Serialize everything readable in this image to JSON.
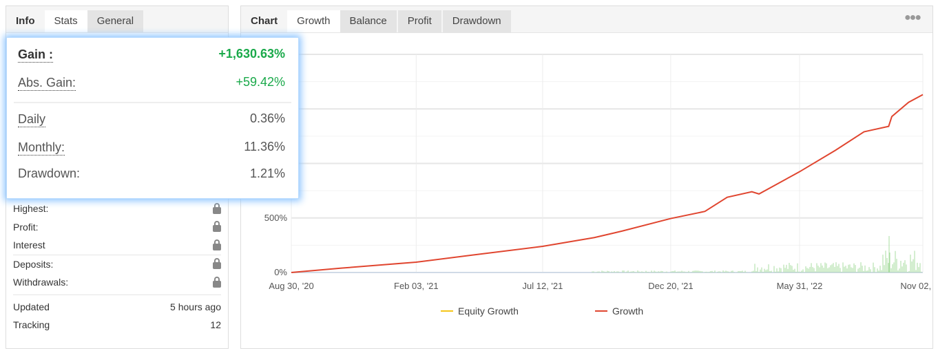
{
  "left": {
    "tabs": [
      "Info",
      "Stats",
      "General"
    ],
    "rows1": [
      {
        "label": "Highest:"
      },
      {
        "label": "Profit:"
      },
      {
        "label": "Interest"
      }
    ],
    "rows2": [
      {
        "label": "Deposits:"
      },
      {
        "label": "Withdrawals:"
      }
    ],
    "rows3": [
      {
        "label": "Updated",
        "value": "5 hours ago"
      },
      {
        "label": "Tracking",
        "value": "12"
      }
    ]
  },
  "popup": {
    "gain_label": "Gain :",
    "gain": "+1,630.63%",
    "abs_label": "Abs. Gain:",
    "abs": "+59.42%",
    "daily_label": "Daily",
    "daily": "0.36%",
    "monthly_label": "Monthly:",
    "monthly": "11.36%",
    "dd_label": "Drawdown:",
    "dd": "1.21%"
  },
  "right": {
    "tabs": [
      "Chart",
      "Growth",
      "Balance",
      "Profit",
      "Drawdown"
    ],
    "active_tab": "Growth",
    "menu_icon": "more-dots-icon"
  },
  "colors": {
    "growth": "#e0452f",
    "equity": "#f5c518",
    "profit_bars": "#a8dca0",
    "gain": "#1aa94a"
  },
  "chart_data": {
    "type": "line",
    "ylim": [
      0,
      2000
    ],
    "yticks": [
      "0%",
      "500%"
    ],
    "ytick_values": [
      0,
      500
    ],
    "xticks": [
      "Aug 30, '20",
      "Feb 03, '21",
      "Jul 12, '21",
      "Dec 20, '21",
      "May 31, '22",
      "Nov 02, '22"
    ],
    "xtick_dates": [
      "2020-08-30",
      "2021-02-03",
      "2021-07-12",
      "2021-12-20",
      "2022-05-31",
      "2022-11-02"
    ],
    "grid": true,
    "legend": "bottom",
    "series": [
      {
        "name": "Equity Growth",
        "color": "#f5c518",
        "x": [],
        "y": []
      },
      {
        "name": "Growth",
        "color": "#e0452f",
        "x": [
          "2020-08-30",
          "2020-11-01",
          "2021-02-03",
          "2021-04-15",
          "2021-07-12",
          "2021-09-15",
          "2021-10-20",
          "2021-12-20",
          "2022-02-01",
          "2022-03-01",
          "2022-04-01",
          "2022-04-10",
          "2022-05-31",
          "2022-07-15",
          "2022-08-20",
          "2022-09-20",
          "2022-09-24",
          "2022-10-15",
          "2022-11-02"
        ],
        "y": [
          0,
          40,
          95,
          160,
          240,
          320,
          380,
          495,
          560,
          690,
          740,
          720,
          924,
          1120,
          1290,
          1340,
          1430,
          1560,
          1630.63
        ]
      }
    ]
  }
}
